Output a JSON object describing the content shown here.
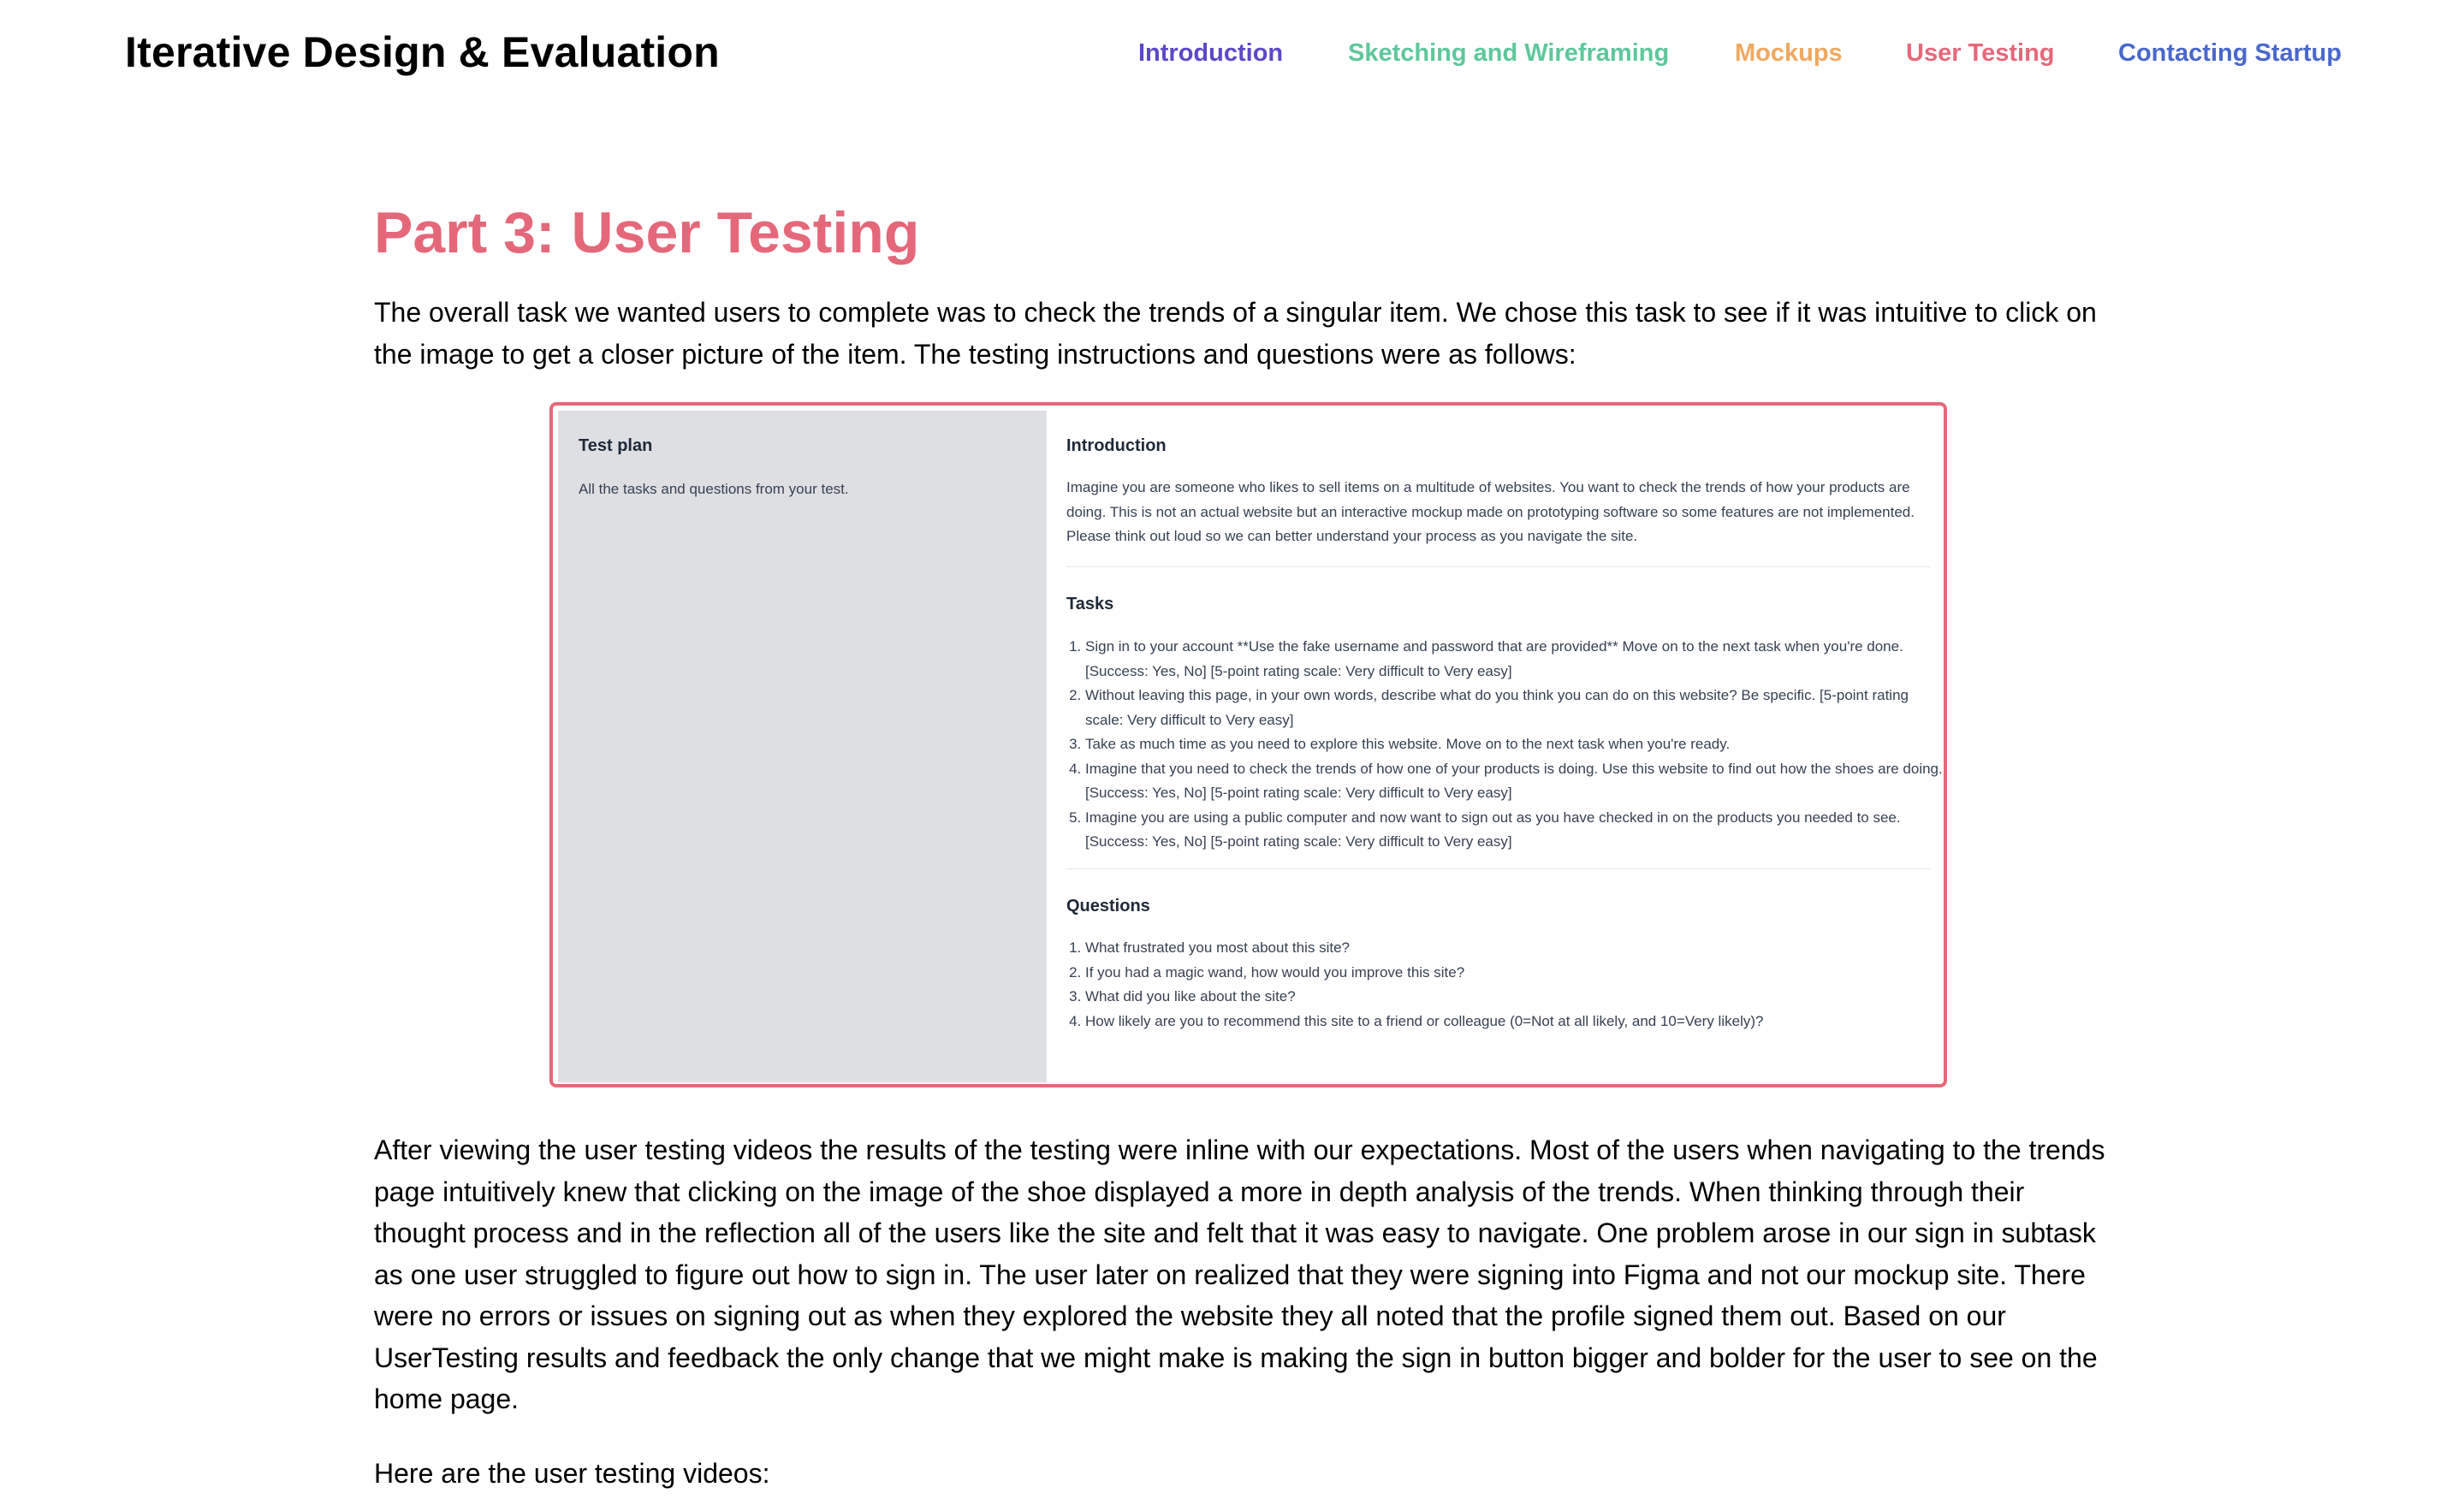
{
  "header": {
    "site_title": "Iterative Design & Evaluation",
    "nav": [
      {
        "label": "Introduction",
        "color": "#5b48c7"
      },
      {
        "label": "Sketching and Wireframing",
        "color": "#5ec79b"
      },
      {
        "label": "Mockups",
        "color": "#f0a860"
      },
      {
        "label": "User Testing",
        "color": "#e5687a"
      },
      {
        "label": "Contacting Startup",
        "color": "#4a67cc"
      }
    ]
  },
  "main": {
    "title": "Part 3: User Testing",
    "title_color": "#e5687a",
    "intro": "The overall task we wanted users to complete was to check the trends of a singular item. We chose this task to see if it was intuitive to click on the image to get a closer picture of the item. The testing instructions and questions were as follows:",
    "results": "After viewing the user testing videos the results of the testing were inline with our expectations. Most of the users when navigating to the trends page intuitively knew that clicking on the image of the shoe displayed a more in depth analysis of the trends. When thinking through their thought process and in the reflection all of the users like the site and felt that it was easy to navigate. One problem arose in our sign in subtask as one user struggled to figure out how to sign in. The user later on realized that they were signing into Figma and not our mockup site. There were no errors or issues on signing out as when they explored the website they all noted that the profile signed them out. Based on our UserTesting results and feedback the only change that we might make is making the sign in button bigger and bolder for the user to see on the home page.",
    "videos_intro": "Here are the user testing videos:"
  },
  "test_plan": {
    "border_color": "#e5687a",
    "left_title": "Test plan",
    "left_desc": "All the tasks and questions from your test.",
    "intro_title": "Introduction",
    "intro_text": "Imagine you are someone who likes to sell items on a multitude of websites. You want to check the trends of how your products are doing. This is not an actual website but an interactive mockup made on prototyping software so some features are not implemented. Please think out loud so we can better understand your process as you navigate the site.",
    "tasks_title": "Tasks",
    "tasks": [
      "Sign in to your account **Use the fake username and password that are provided** Move on to the next task when you're done. [Success: Yes, No] [5-point rating scale: Very difficult to Very easy]",
      "Without leaving this page, in your own words, describe what do you think you can do on this website? Be specific.  [5-point rating scale: Very difficult to Very easy]",
      "Take as much time as you need to explore this website. Move on to the next task when you're ready.",
      "Imagine that you need to check the trends of how one of your products is doing. Use this website to find out how the shoes are doing. [Success: Yes, No] [5-point rating scale: Very difficult to Very easy]",
      "Imagine you are using a public computer and now want to sign out as you have checked in on the products you needed to see. [Success: Yes, No] [5-point rating scale: Very difficult to Very easy]"
    ],
    "questions_title": "Questions",
    "questions": [
      "What frustrated you most about this site?",
      "If you had a magic wand, how would you improve this site?",
      "What did you like about the site?",
      "How likely are you to recommend this site to a friend or colleague (0=Not at all likely, and 10=Very likely)?"
    ]
  }
}
